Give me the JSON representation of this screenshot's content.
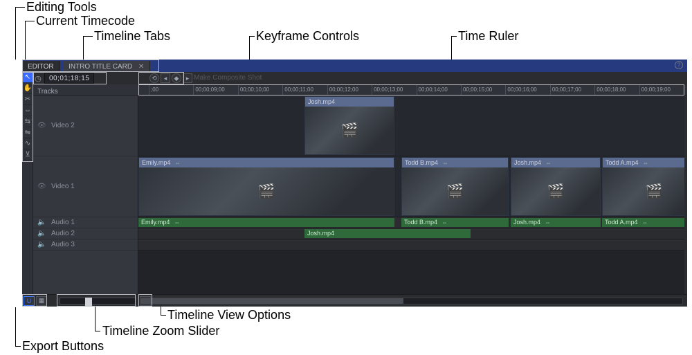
{
  "annotations": {
    "editing_tools": "Editing Tools",
    "current_timecode": "Current Timecode",
    "timeline_tabs": "Timeline Tabs",
    "keyframe_controls": "Keyframe Controls",
    "time_ruler": "Time Ruler",
    "timeline_view_options": "Timeline View Options",
    "timeline_zoom_slider": "Timeline Zoom Slider",
    "export_buttons": "Export Buttons"
  },
  "tabs": {
    "editor": "EDITOR",
    "second": "INTRO TITLE CARD",
    "close": "✕"
  },
  "row2": {
    "clock_glyph": "◷",
    "timecode": "00;01;18;15",
    "kf_home": "⟲",
    "kf_prev": "◂",
    "kf_key": "◆",
    "kf_next": "▸",
    "header": "Make Composite Shot"
  },
  "tracks_label": "Tracks",
  "ruler": [
    ";00",
    "00;00;09;00",
    "00;00;10;00",
    "00;00;11;00",
    "00;00;12;00",
    "00;00;13;00",
    "00;00;14;00",
    "00;00;15;00",
    "00;00;16;00",
    "00;00;17;00",
    "00;00;18;00",
    "00;00;19;00"
  ],
  "tools": {
    "select": "↖",
    "hand": "✋",
    "slice": "✂",
    "slip": "⇔",
    "ripple": "⇆",
    "roll": "⇋",
    "rate": "∿",
    "snap": "⊻"
  },
  "track_headers": {
    "video2": "Video 2",
    "video1": "Video 1",
    "audio1": "Audio 1",
    "audio2": "Audio 2",
    "audio3": "Audio 3",
    "eye": "👁",
    "spk": "🔈"
  },
  "clips": {
    "video2": {
      "josh": "Josh.mp4"
    },
    "video1": {
      "emily": "Emily.mp4",
      "toddb": "Todd B.mp4",
      "josh": "Josh.mp4",
      "todda": "Todd A.mp4"
    },
    "link": "⇔",
    "audio1": {
      "emily": "Emily.mp4",
      "toddb": "Todd B.mp4",
      "josh": "Josh.mp4",
      "todda": "Todd A.mp4"
    },
    "audio2": {
      "josh": "Josh.mp4"
    }
  },
  "bottom": {
    "export1": "U",
    "export2": "▦",
    "options": "▤"
  }
}
